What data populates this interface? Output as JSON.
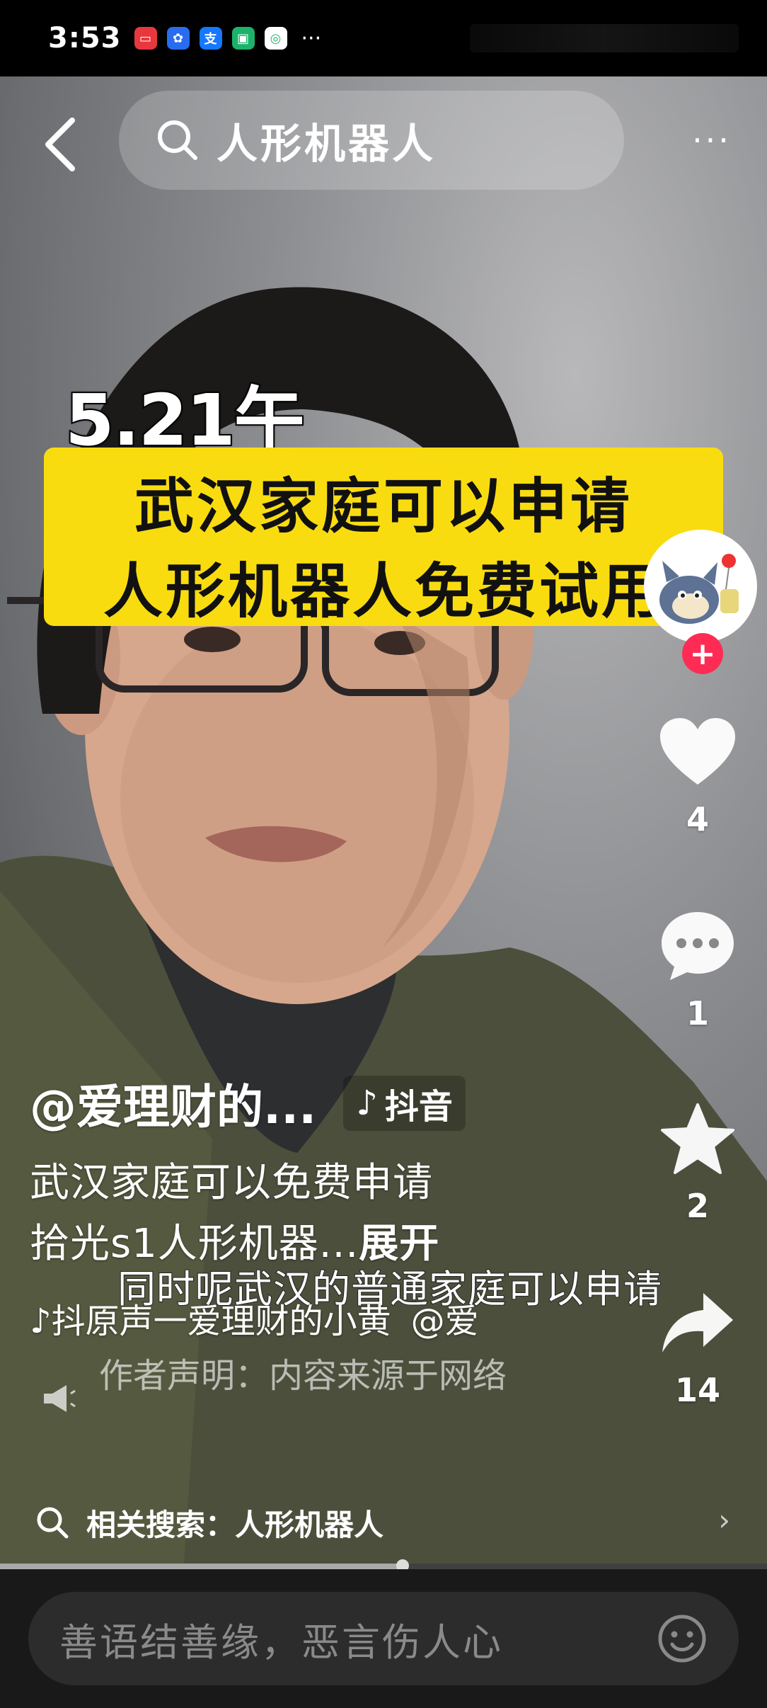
{
  "status_bar": {
    "time": "3:53",
    "more": "···"
  },
  "top_bar": {
    "search_query": "人形机器人",
    "more_label": "···"
  },
  "video": {
    "caption_date": "5.21午",
    "caption_line1": "武汉家庭可以申请",
    "caption_line2": "人形机器人免费试用",
    "subtitle": "同时呢武汉的普通家庭可以申请"
  },
  "actions": {
    "follow_label": "+",
    "likes": "4",
    "comments": "1",
    "favorites": "2",
    "shares": "14"
  },
  "info": {
    "author": "@爱理财的...",
    "platform_badge": "抖音",
    "description_line1": "武汉家庭可以免费申请",
    "description_line2": "拾光s1人形机器...",
    "expand_label": "展开",
    "music": "♪抖原声一爱理财的小黄",
    "mention": "@爱",
    "statement": "作者声明：内容来源于网络"
  },
  "related_search": {
    "label": "相关搜索：人形机器人",
    "arrow": "›"
  },
  "progress": {
    "fraction": 0.525
  },
  "comment": {
    "placeholder": "善语结善缘，恶言伤人心"
  }
}
